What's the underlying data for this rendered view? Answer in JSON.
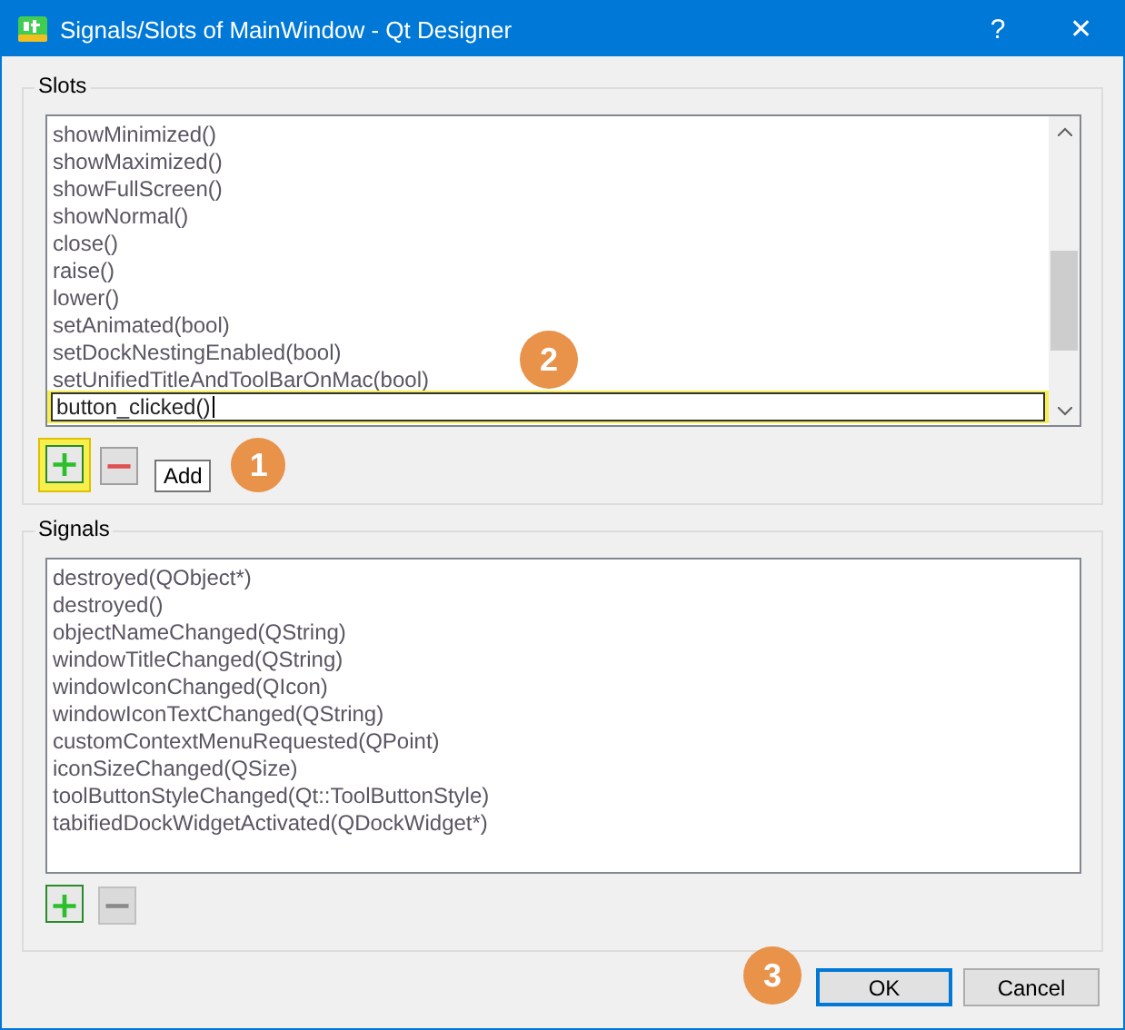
{
  "window": {
    "title": "Signals/Slots of MainWindow - Qt Designer",
    "buttons": [
      "?",
      "✕"
    ]
  },
  "slots": {
    "label": "Slots",
    "items": [
      "showMinimized()",
      "showMaximized()",
      "showFullScreen()",
      "showNormal()",
      "close()",
      "raise()",
      "lower()",
      "setAnimated(bool)",
      "setDockNestingEnabled(bool)",
      "setUnifiedTitleAndToolBarOnMac(bool)"
    ],
    "editor": {
      "value": "button_clicked()",
      "highlighted": true,
      "badge": "2"
    },
    "add": {
      "label": "+",
      "disabled": false,
      "highlighted": true,
      "tooltip": "Add",
      "badge": "1"
    },
    "remove": {
      "label": "−",
      "disabled": false
    }
  },
  "signals": {
    "label": "Signals",
    "items": [
      "destroyed(QObject*)",
      "destroyed()",
      "objectNameChanged(QString)",
      "windowTitleChanged(QString)",
      "windowIconChanged(QIcon)",
      "windowIconTextChanged(QString)",
      "customContextMenuRequested(QPoint)",
      "iconSizeChanged(QSize)",
      "toolButtonStyleChanged(Qt::ToolButtonStyle)",
      "tabifiedDockWidgetActivated(QDockWidget*)"
    ],
    "add": {
      "label": "+",
      "disabled": false,
      "highlighted": false
    },
    "remove": {
      "label": "−",
      "disabled": true
    }
  },
  "buttons": [
    {
      "label": "OK",
      "default": true,
      "badge": "3"
    },
    {
      "label": "Cancel",
      "default": false
    }
  ]
}
